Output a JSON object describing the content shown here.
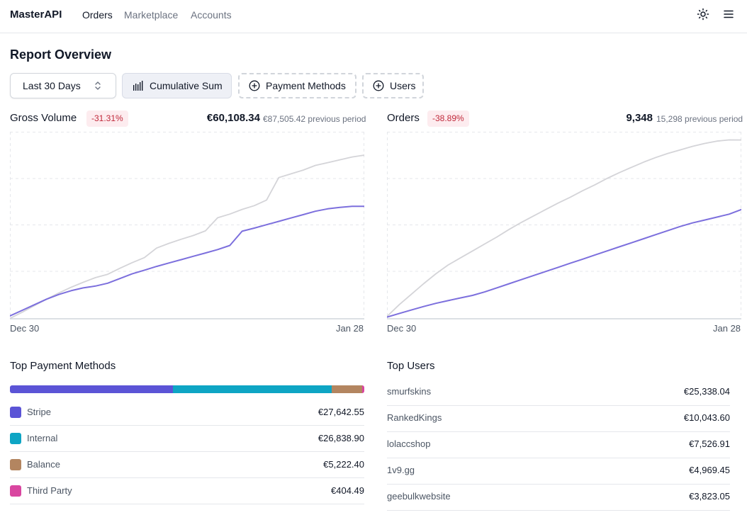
{
  "header": {
    "brand": "MasterAPI",
    "nav": [
      {
        "label": "Orders",
        "active": true
      },
      {
        "label": "Marketplace",
        "active": false
      },
      {
        "label": "Accounts",
        "active": false
      }
    ],
    "icons": [
      "sun-icon",
      "menu-icon"
    ]
  },
  "page": {
    "title": "Report Overview",
    "controls": {
      "period": "Last 30 Days",
      "cumulative": "Cumulative Sum",
      "payment_methods": "Payment Methods",
      "users": "Users"
    }
  },
  "colors": {
    "current_line": "#7c6fdd",
    "previous_line": "#d4d4d8",
    "badge_bg": "#fdecef",
    "badge_text": "#c0283a"
  },
  "charts": {
    "gross": {
      "title": "Gross Volume",
      "change": "-31.31%",
      "value": "€60,108.34",
      "previous": "€87,505.42 previous period",
      "x_start": "Dec 30",
      "x_end": "Jan 28"
    },
    "orders": {
      "title": "Orders",
      "change": "-38.89%",
      "value": "9,348",
      "previous": "15,298 previous period",
      "x_start": "Dec 30",
      "x_end": "Jan 28"
    }
  },
  "chart_data": [
    {
      "type": "line",
      "title": "Gross Volume",
      "x": [
        "Dec 30",
        "Jan 28"
      ],
      "ylim": [
        0,
        100000
      ],
      "series": [
        {
          "values": [
            1500,
            4500,
            7500,
            10500,
            13000,
            15000,
            16500,
            17500,
            19000,
            21500,
            24000,
            26000,
            28000,
            29800,
            31600,
            33400,
            35200,
            37000,
            39200,
            46800,
            48500,
            50300,
            52100,
            53900,
            55700,
            57500,
            58800,
            59600,
            60100,
            60108.34
          ]
        },
        {
          "values": [
            200,
            3500,
            7000,
            10500,
            13800,
            16800,
            19500,
            22000,
            23800,
            27000,
            30000,
            32700,
            37800,
            40300,
            42500,
            44500,
            47000,
            54000,
            56000,
            58500,
            60500,
            63500,
            75500,
            77500,
            79500,
            82000,
            83500,
            85000,
            86500,
            87505.42
          ]
        }
      ]
    },
    {
      "type": "line",
      "title": "Orders",
      "x": [
        "Dec 30",
        "Jan 28"
      ],
      "ylim": [
        0,
        16000
      ],
      "series": [
        {
          "values": [
            140,
            450,
            750,
            1050,
            1320,
            1550,
            1780,
            2000,
            2300,
            2650,
            3000,
            3350,
            3700,
            4050,
            4400,
            4750,
            5100,
            5450,
            5800,
            6150,
            6500,
            6850,
            7200,
            7550,
            7900,
            8200,
            8450,
            8700,
            8950,
            9348
          ]
        },
        {
          "values": [
            200,
            1200,
            2100,
            3000,
            3850,
            4600,
            5200,
            5800,
            6400,
            7000,
            7650,
            8250,
            8800,
            9350,
            9900,
            10400,
            10950,
            11450,
            12000,
            12500,
            12950,
            13400,
            13800,
            14150,
            14450,
            14750,
            15000,
            15200,
            15300,
            15298
          ]
        }
      ]
    }
  ],
  "payment_methods": {
    "title": "Top Payment Methods",
    "bar_fractions": [
      0.46,
      0.447,
      0.087,
      0.006
    ],
    "items": [
      {
        "name": "Stripe",
        "value": "€27,642.55",
        "color": "#5b54d6"
      },
      {
        "name": "Internal",
        "value": "€26,838.90",
        "color": "#0ea5c4"
      },
      {
        "name": "Balance",
        "value": "€5,222.40",
        "color": "#b38560"
      },
      {
        "name": "Third Party",
        "value": "€404.49",
        "color": "#d946a0"
      }
    ]
  },
  "top_users": {
    "title": "Top Users",
    "items": [
      {
        "name": "smurfskins",
        "value": "€25,338.04"
      },
      {
        "name": "RankedKings",
        "value": "€10,043.60"
      },
      {
        "name": "lolaccshop",
        "value": "€7,526.91"
      },
      {
        "name": "1v9.gg",
        "value": "€4,969.45"
      },
      {
        "name": "geebulkwebsite",
        "value": "€3,823.05"
      }
    ]
  }
}
